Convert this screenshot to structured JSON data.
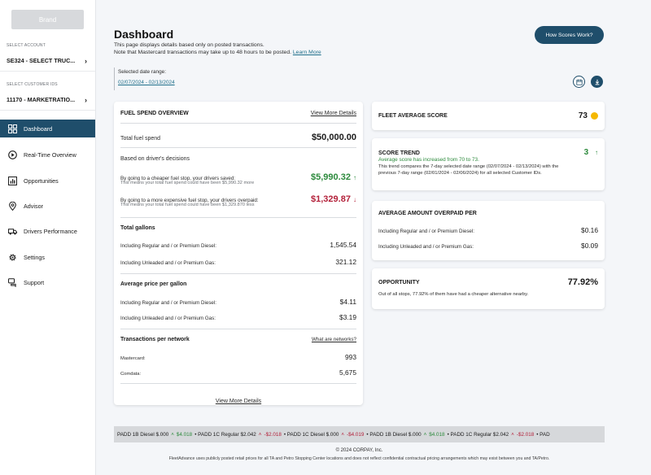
{
  "sidebar": {
    "brand": "Brand",
    "account_label": "SELECT ACCOUNT",
    "account_value": "SE324 - SELECT TRUC...",
    "customer_label": "SELECT CUSTOMER IDS",
    "customer_value": "11170 - MARKETRATIO...",
    "nav": [
      {
        "label": "Dashboard",
        "icon": "grid-icon"
      },
      {
        "label": "Real-Time Overview",
        "icon": "play-circle-icon"
      },
      {
        "label": "Opportunities",
        "icon": "chart-icon"
      },
      {
        "label": "Advisor",
        "icon": "location-pin-icon"
      },
      {
        "label": "Drivers Performance",
        "icon": "truck-icon"
      },
      {
        "label": "Settings",
        "icon": "gear-icon"
      },
      {
        "label": "Support",
        "icon": "chat-icon"
      }
    ]
  },
  "header": {
    "title": "Dashboard",
    "subtitle1": "This page displays details based only on posted transactions.",
    "subtitle2": "Note that Mastercard transactions may take up to 48 hours to be posted.",
    "learn_more": "Learn More",
    "how_button": "How Scores Work?",
    "date_label": "Selected date range:",
    "date_range": "02/07/2024 - 02/13/2024"
  },
  "fuel": {
    "title": "FUEL SPEND OVERVIEW",
    "view_more": "View More Details",
    "total_label": "Total fuel spend",
    "total_value": "$50,000.00",
    "decisions_title": "Based on driver's decisions",
    "saved_label": "By going to a cheaper fuel stop, your drivers saved:",
    "saved_note": "This means your total fuel spend could have been $5,990.32 more",
    "saved_value": "$5,990.32",
    "overpaid_label": "By going to a more expensive fuel stop, your drivers overpaid:",
    "overpaid_note": "This means your total fuel spend could have been $1,329.870 less",
    "overpaid_value": "$1,329.87",
    "gallons_title": "Total gallons",
    "gal_diesel_label": "Including Regular and / or Premium Diesel:",
    "gal_diesel_value": "1,545.54",
    "gal_gas_label": "Including Unleaded and / or Premium Gas:",
    "gal_gas_value": "321.12",
    "price_title": "Average price per gallon",
    "price_diesel_label": "Including Regular and / or Premium Diesel:",
    "price_diesel_value": "$4.11",
    "price_gas_label": "Including Unleaded and / or Premium Gas:",
    "price_gas_value": "$3.19",
    "network_title": "Transactions per network",
    "network_link": "What are networks?",
    "mastercard_label": "Mastercard:",
    "mastercard_value": "993",
    "comdata_label": "Comdata:",
    "comdata_value": "5,675",
    "bottom_link": "View More Details"
  },
  "fleet": {
    "title": "FLEET AVERAGE SCORE",
    "value": "73",
    "dot_color": "#f5b800"
  },
  "trend": {
    "title": "SCORE TREND",
    "value": "3",
    "headline": "Average score has increased from 70 to 73.",
    "desc1": "This trend compares the 7-day selected date range (02/07/2024 - 02/13/2024) with the",
    "desc2": "previous 7-day range (02/01/2024 - 02/06/2024) for all selected Customer IDs."
  },
  "overpaid": {
    "title": "AVERAGE AMOUNT OVERPAID PER",
    "diesel_label": "Including Regular and / or Premium Diesel:",
    "diesel_value": "$0.16",
    "gas_label": "Including Unleaded and / or Premium Gas:",
    "gas_value": "$0.09"
  },
  "opportunity": {
    "title": "OPPORTUNITY",
    "value": "77.92%",
    "desc": "Out of all stops, 77.92% of them have had a cheaper alternative nearby."
  },
  "ticker": {
    "t1": "PADD 1B Diesel $.000",
    "t2": "$4.018",
    "t3": "• PADD 1C Regular $2.042",
    "t4": "-$2.018",
    "t5": "• PADD 1C Diesel $.000",
    "t6": "-$4.019",
    "t7": "• PADD 1B Diesel $.000",
    "t8": "$4.018",
    "t9": "• PADD 1C Regular $2.042",
    "t10": "-$2.018",
    "t11": "• PAD"
  },
  "footer": {
    "copyright": "© 2024 CORPAY, Inc.",
    "disclaimer": "FleetAdvance uses publicly posted retail prices for all TA and Petro Stopping Center locations and does not reflect confidential contractual pricing arrangements which may exist between you and TA/Petro."
  },
  "colors": {
    "primary": "#1f4e6b",
    "positive": "#2c8a3c",
    "negative": "#b3213a",
    "link": "#1f6f8b"
  }
}
